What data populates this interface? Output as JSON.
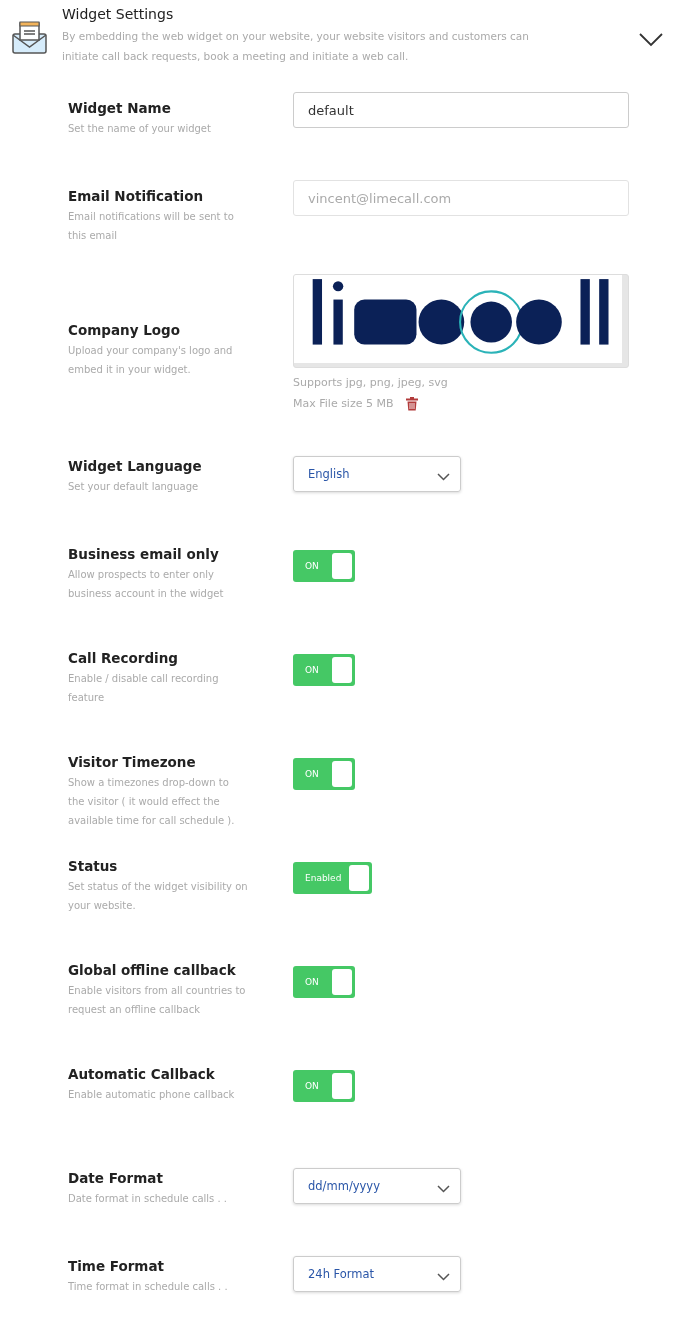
{
  "header": {
    "title": "Widget Settings",
    "description": "By embedding the web widget on your website, your website visitors and customers can initiate call back requests, book a meeting and initiate a web call.",
    "expanded": true
  },
  "rows": [
    {
      "kind": "text",
      "label": "Widget Name",
      "description": "Set the name of your widget",
      "value": "default"
    },
    {
      "kind": "text",
      "label": "Email Notification",
      "description": "Email notifications will be sent to this email",
      "placeholder": "vincent@limecall.com"
    },
    {
      "kind": "logo",
      "label": "Company Logo",
      "description": "Upload your company's logo and embed it in your widget.",
      "supports": "Supports jpg, png, jpeg, svg",
      "max_size": "Max File size 5 MB"
    },
    {
      "kind": "select",
      "label": "Widget Language",
      "description": "Set your default language",
      "value": "English"
    },
    {
      "kind": "toggle",
      "label": "Business email only",
      "description": "Allow prospects to enter only business account in the widget",
      "on": true,
      "toggle_text": "ON"
    },
    {
      "kind": "toggle",
      "label": "Call Recording",
      "description": "Enable / disable call recording feature",
      "on": true,
      "toggle_text": "ON"
    },
    {
      "kind": "toggle",
      "label": "Visitor Timezone",
      "description": "Show a timezones drop-down to the visitor ( it would effect the available time for call schedule ).",
      "on": true,
      "toggle_text": "ON"
    },
    {
      "kind": "toggle",
      "label": "Status",
      "description": "Set status of the widget visibility on your website.",
      "on": true,
      "toggle_text": "Enabled"
    },
    {
      "kind": "toggle",
      "label": "Global offline callback",
      "description": "Enable visitors from all countries to request an offline callback",
      "on": true,
      "toggle_text": "ON"
    },
    {
      "kind": "toggle",
      "label": "Automatic Callback",
      "description": "Enable automatic phone callback",
      "on": true,
      "toggle_text": "ON"
    },
    {
      "kind": "select",
      "label": "Date Format",
      "description": "Date format in schedule calls . .",
      "value": "dd/mm/yyyy"
    },
    {
      "kind": "select",
      "label": "Time Format",
      "description": "Time format in schedule calls . .",
      "value": "24h Format"
    }
  ]
}
